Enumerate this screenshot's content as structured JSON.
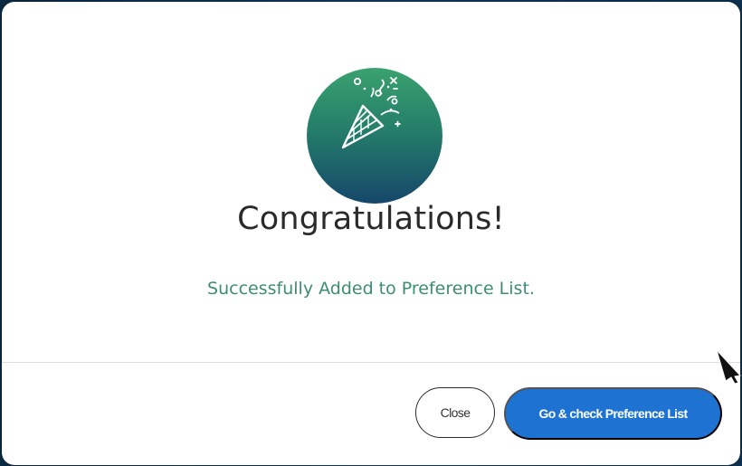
{
  "modal": {
    "icon": "party-popper-icon",
    "title": "Congratulations!",
    "message": "Successfully Added to Preference List.",
    "buttons": {
      "close_label": "Close",
      "primary_label": "Go & check Preference List"
    }
  },
  "colors": {
    "badge_gradient_top": "#3aa26f",
    "badge_gradient_bottom": "#15476a",
    "message_text": "#3c8d73",
    "primary_button": "#1d72d2",
    "title_text": "#2a2a2a"
  }
}
